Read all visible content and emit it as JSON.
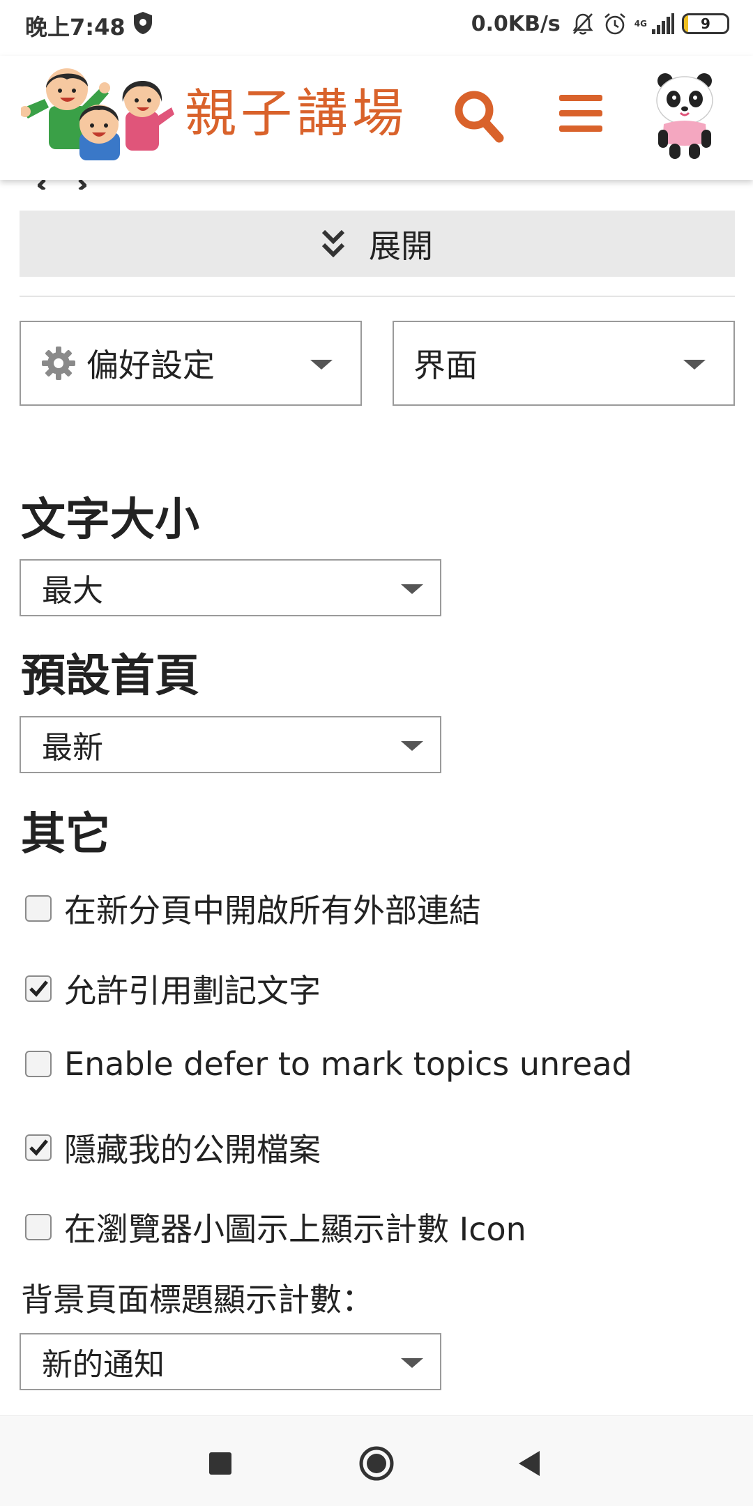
{
  "status_bar": {
    "time": "晚上7:48",
    "net_speed": "0.0KB/s",
    "network_type": "4G",
    "battery_level": "9",
    "battery_fraction": 0.09,
    "icons": [
      "shield-icon",
      "bell-muted-icon",
      "alarm-icon",
      "signal-icon",
      "battery-icon"
    ]
  },
  "header": {
    "site_title": "親子講場",
    "accent_color": "#d9622b",
    "icons": [
      "family-logo-icon",
      "search-icon",
      "hamburger-menu-icon",
      "panda-avatar-icon"
    ]
  },
  "expand": {
    "label": "展開",
    "icon": "double-chevron-down-icon"
  },
  "nav": {
    "preferences_label": "偏好設定",
    "interface_label": "界面"
  },
  "settings": {
    "font_size": {
      "heading": "文字大小",
      "value": "最大"
    },
    "default_home": {
      "heading": "預設首頁",
      "value": "最新"
    },
    "other": {
      "heading": "其它",
      "options": [
        {
          "label": "在新分頁中開啟所有外部連結",
          "checked": false
        },
        {
          "label": "允許引用劃記文字",
          "checked": true
        },
        {
          "label": "Enable defer to mark topics unread",
          "checked": false
        },
        {
          "label": "隱藏我的公開檔案",
          "checked": true
        },
        {
          "label": "在瀏覽器小圖示上顯示計數 Icon",
          "checked": false
        }
      ]
    },
    "bg_title_count": {
      "label": "背景頁面標題顯示計數：",
      "value": "新的通知"
    }
  },
  "system_nav": {
    "icons": [
      "recents-square-icon",
      "home-circle-icon",
      "back-triangle-icon"
    ]
  }
}
